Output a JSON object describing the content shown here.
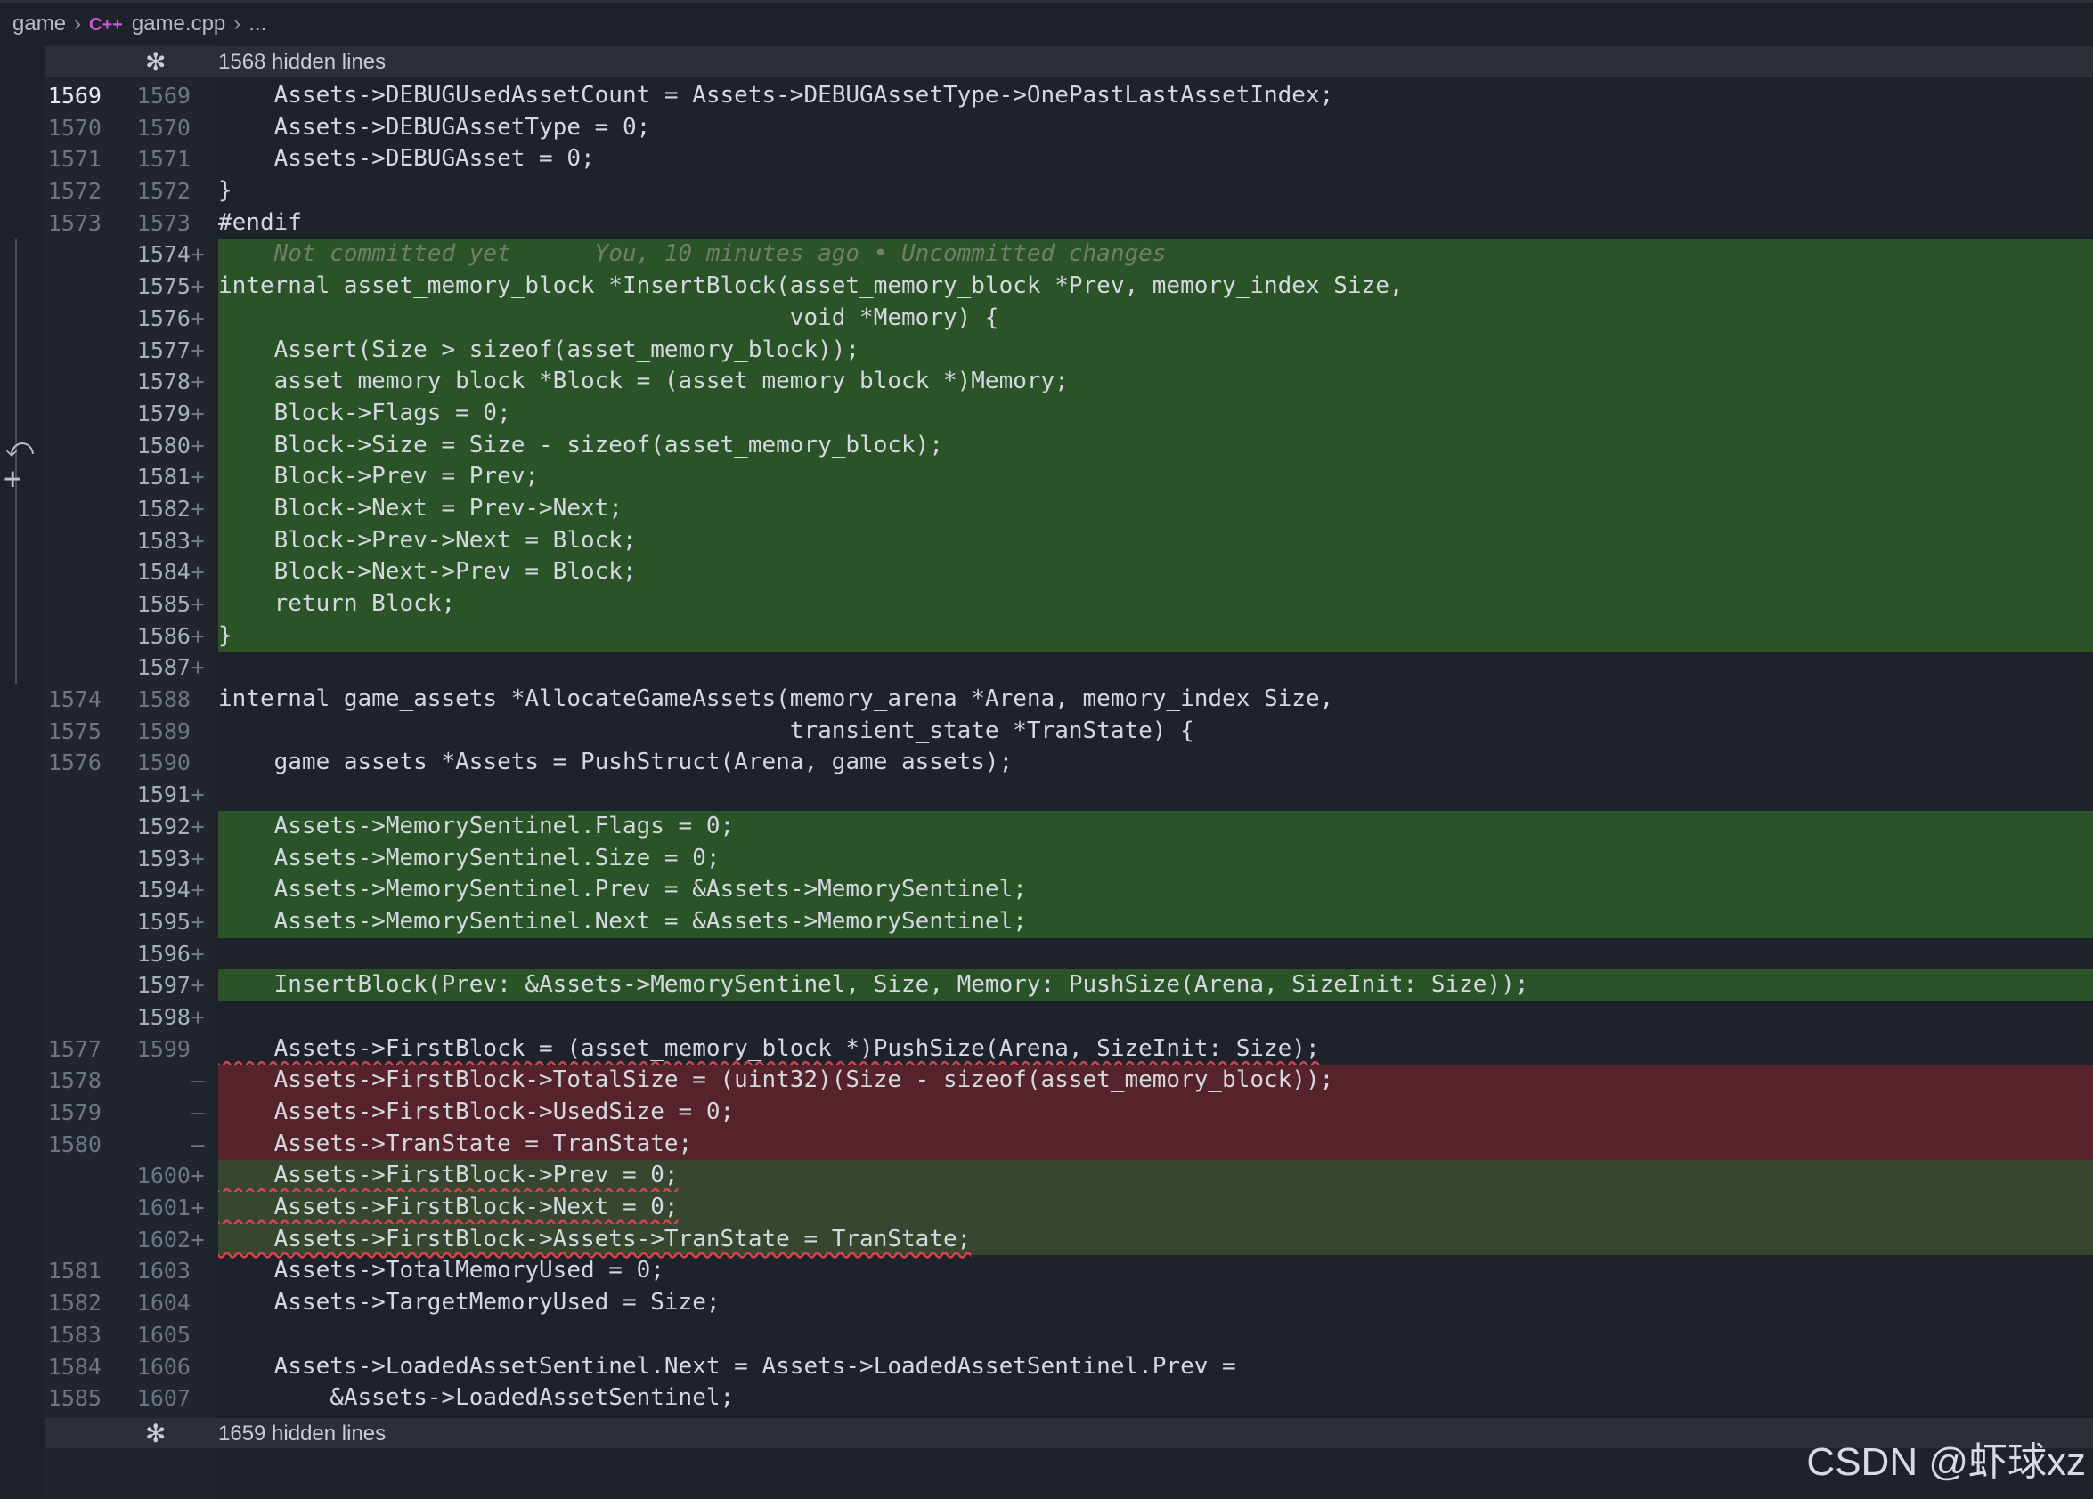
{
  "breadcrumb": {
    "folder": "game",
    "file_icon": "C++",
    "file": "game.cpp",
    "more": "..."
  },
  "fold_top": {
    "icon": "fold-gear-icon",
    "label": "1568 hidden lines"
  },
  "fold_bottom": {
    "icon": "fold-gear-icon",
    "label": "1659 hidden lines"
  },
  "colors": {
    "added": "#2b5328",
    "removed": "#56222b",
    "modified": "#38452f",
    "squiggle": "#d5434f"
  },
  "lines": [
    {
      "l": "1569",
      "r": "1569",
      "m": "",
      "t": "    Assets->DEBUGUsedAssetCount = Assets->DEBUGAssetType->OnePastLastAssetIndex;",
      "k": "",
      "cur": true
    },
    {
      "l": "1570",
      "r": "1570",
      "m": "",
      "t": "    Assets->DEBUGAssetType = 0;",
      "k": ""
    },
    {
      "l": "1571",
      "r": "1571",
      "m": "",
      "t": "    Assets->DEBUGAsset = 0;",
      "k": ""
    },
    {
      "l": "1572",
      "r": "1572",
      "m": "",
      "t": "}",
      "k": ""
    },
    {
      "l": "1573",
      "r": "1573",
      "m": "",
      "t": "#endif",
      "k": ""
    },
    {
      "l": "",
      "r": "1574",
      "m": "+",
      "t": "    Not committed yet      You, 10 minutes ago • Uncommitted changes",
      "k": "add blame"
    },
    {
      "l": "",
      "r": "1575",
      "m": "+",
      "t": "internal asset_memory_block *InsertBlock(asset_memory_block *Prev, memory_index Size,",
      "k": "add"
    },
    {
      "l": "",
      "r": "1576",
      "m": "+",
      "t": "                                         void *Memory) {",
      "k": "add"
    },
    {
      "l": "",
      "r": "1577",
      "m": "+",
      "t": "    Assert(Size > sizeof(asset_memory_block));",
      "k": "add"
    },
    {
      "l": "",
      "r": "1578",
      "m": "+",
      "t": "    asset_memory_block *Block = (asset_memory_block *)Memory;",
      "k": "add"
    },
    {
      "l": "",
      "r": "1579",
      "m": "+",
      "t": "    Block->Flags = 0;",
      "k": "add"
    },
    {
      "l": "",
      "r": "1580",
      "m": "+",
      "t": "    Block->Size = Size - sizeof(asset_memory_block);",
      "k": "add"
    },
    {
      "l": "",
      "r": "1581",
      "m": "+",
      "t": "    Block->Prev = Prev;",
      "k": "add"
    },
    {
      "l": "",
      "r": "1582",
      "m": "+",
      "t": "    Block->Next = Prev->Next;",
      "k": "add"
    },
    {
      "l": "",
      "r": "1583",
      "m": "+",
      "t": "    Block->Prev->Next = Block;",
      "k": "add"
    },
    {
      "l": "",
      "r": "1584",
      "m": "+",
      "t": "    Block->Next->Prev = Block;",
      "k": "add"
    },
    {
      "l": "",
      "r": "1585",
      "m": "+",
      "t": "    return Block;",
      "k": "add"
    },
    {
      "l": "",
      "r": "1586",
      "m": "+",
      "t": "}",
      "k": "add"
    },
    {
      "l": "",
      "r": "1587",
      "m": "+",
      "t": "",
      "k": "add"
    },
    {
      "l": "1574",
      "r": "1588",
      "m": "",
      "t": "internal game_assets *AllocateGameAssets(memory_arena *Arena, memory_index Size,",
      "k": ""
    },
    {
      "l": "1575",
      "r": "1589",
      "m": "",
      "t": "                                         transient_state *TranState) {",
      "k": ""
    },
    {
      "l": "1576",
      "r": "1590",
      "m": "",
      "t": "    game_assets *Assets = PushStruct(Arena, game_assets);",
      "k": ""
    },
    {
      "l": "",
      "r": "1591",
      "m": "+",
      "t": "",
      "k": "add"
    },
    {
      "l": "",
      "r": "1592",
      "m": "+",
      "t": "    Assets->MemorySentinel.Flags = 0;",
      "k": "add"
    },
    {
      "l": "",
      "r": "1593",
      "m": "+",
      "t": "    Assets->MemorySentinel.Size = 0;",
      "k": "add"
    },
    {
      "l": "",
      "r": "1594",
      "m": "+",
      "t": "    Assets->MemorySentinel.Prev = &Assets->MemorySentinel;",
      "k": "add"
    },
    {
      "l": "",
      "r": "1595",
      "m": "+",
      "t": "    Assets->MemorySentinel.Next = &Assets->MemorySentinel;",
      "k": "add"
    },
    {
      "l": "",
      "r": "1596",
      "m": "+",
      "t": "",
      "k": "add"
    },
    {
      "l": "",
      "r": "1597",
      "m": "+",
      "t": "    InsertBlock(Prev: &Assets->MemorySentinel, Size, Memory: PushSize(Arena, SizeInit: Size));",
      "k": "add"
    },
    {
      "l": "",
      "r": "1598",
      "m": "+",
      "t": "",
      "k": "add"
    },
    {
      "l": "1577",
      "r": "1599",
      "m": "",
      "t": "    Assets->FirstBlock = (asset_memory_block *)PushSize(Arena, SizeInit: Size);",
      "k": "squig"
    },
    {
      "l": "1578",
      "r": "",
      "m": "—",
      "t": "    Assets->FirstBlock->TotalSize = (uint32)(Size - sizeof(asset_memory_block));",
      "k": "del"
    },
    {
      "l": "1579",
      "r": "",
      "m": "—",
      "t": "    Assets->FirstBlock->UsedSize = 0;",
      "k": "del"
    },
    {
      "l": "1580",
      "r": "",
      "m": "—",
      "t": "    Assets->TranState = TranState;",
      "k": "del"
    },
    {
      "l": "",
      "r": "1600",
      "m": "+",
      "t": "    Assets->FirstBlock->Prev = 0;",
      "k": "mod squig"
    },
    {
      "l": "",
      "r": "1601",
      "m": "+",
      "t": "    Assets->FirstBlock->Next = 0;",
      "k": "mod squig"
    },
    {
      "l": "",
      "r": "1602",
      "m": "+",
      "t": "    Assets->FirstBlock->Assets->TranState = TranState;",
      "k": "mod squig"
    },
    {
      "l": "1581",
      "r": "1603",
      "m": "",
      "t": "    Assets->TotalMemoryUsed = 0;",
      "k": ""
    },
    {
      "l": "1582",
      "r": "1604",
      "m": "",
      "t": "    Assets->TargetMemoryUsed = Size;",
      "k": ""
    },
    {
      "l": "1583",
      "r": "1605",
      "m": "",
      "t": "",
      "k": ""
    },
    {
      "l": "1584",
      "r": "1606",
      "m": "",
      "t": "    Assets->LoadedAssetSentinel.Next = Assets->LoadedAssetSentinel.Prev =",
      "k": ""
    },
    {
      "l": "1585",
      "r": "1607",
      "m": "",
      "t": "        &Assets->LoadedAssetSentinel;",
      "k": ""
    }
  ],
  "watermark": "CSDN @虾球xz"
}
